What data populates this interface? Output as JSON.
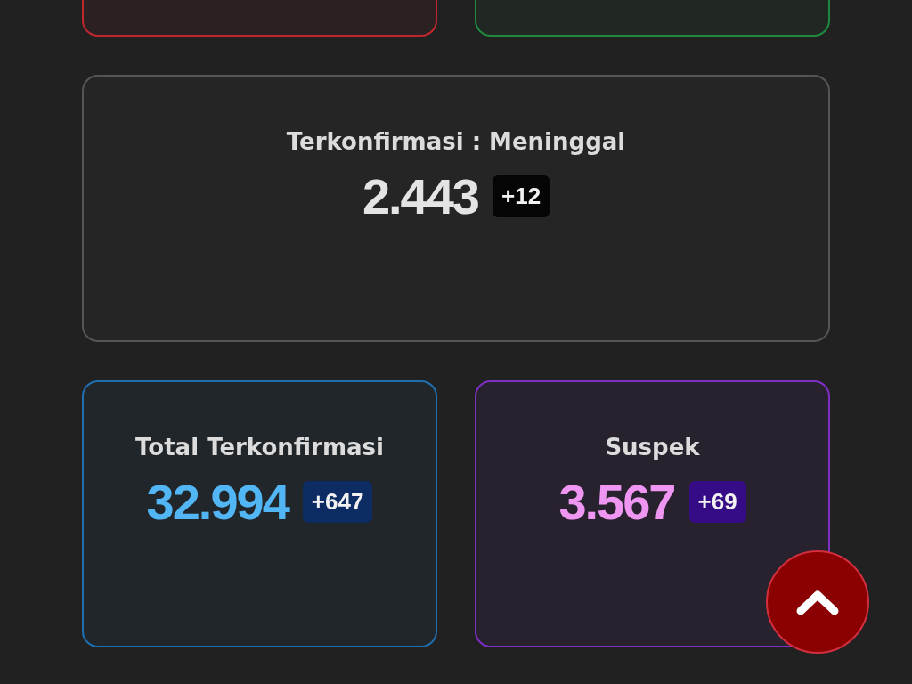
{
  "top_cards": [
    {
      "color": "#c0272d"
    },
    {
      "color": "#1f8a3f"
    }
  ],
  "cards": [
    {
      "kind": "wide",
      "color": "#555555",
      "title": "Terkonfirmasi : Meninggal",
      "value": "2.443",
      "change": "+12"
    },
    {
      "kind": "half",
      "color": "#1f6fb0",
      "title": "Total Terkonfirmasi",
      "value": "32.994",
      "change": "+647"
    },
    {
      "kind": "half",
      "color": "#7d2fc6",
      "title": "Suspek",
      "value": "3.567",
      "change": "+69"
    }
  ]
}
